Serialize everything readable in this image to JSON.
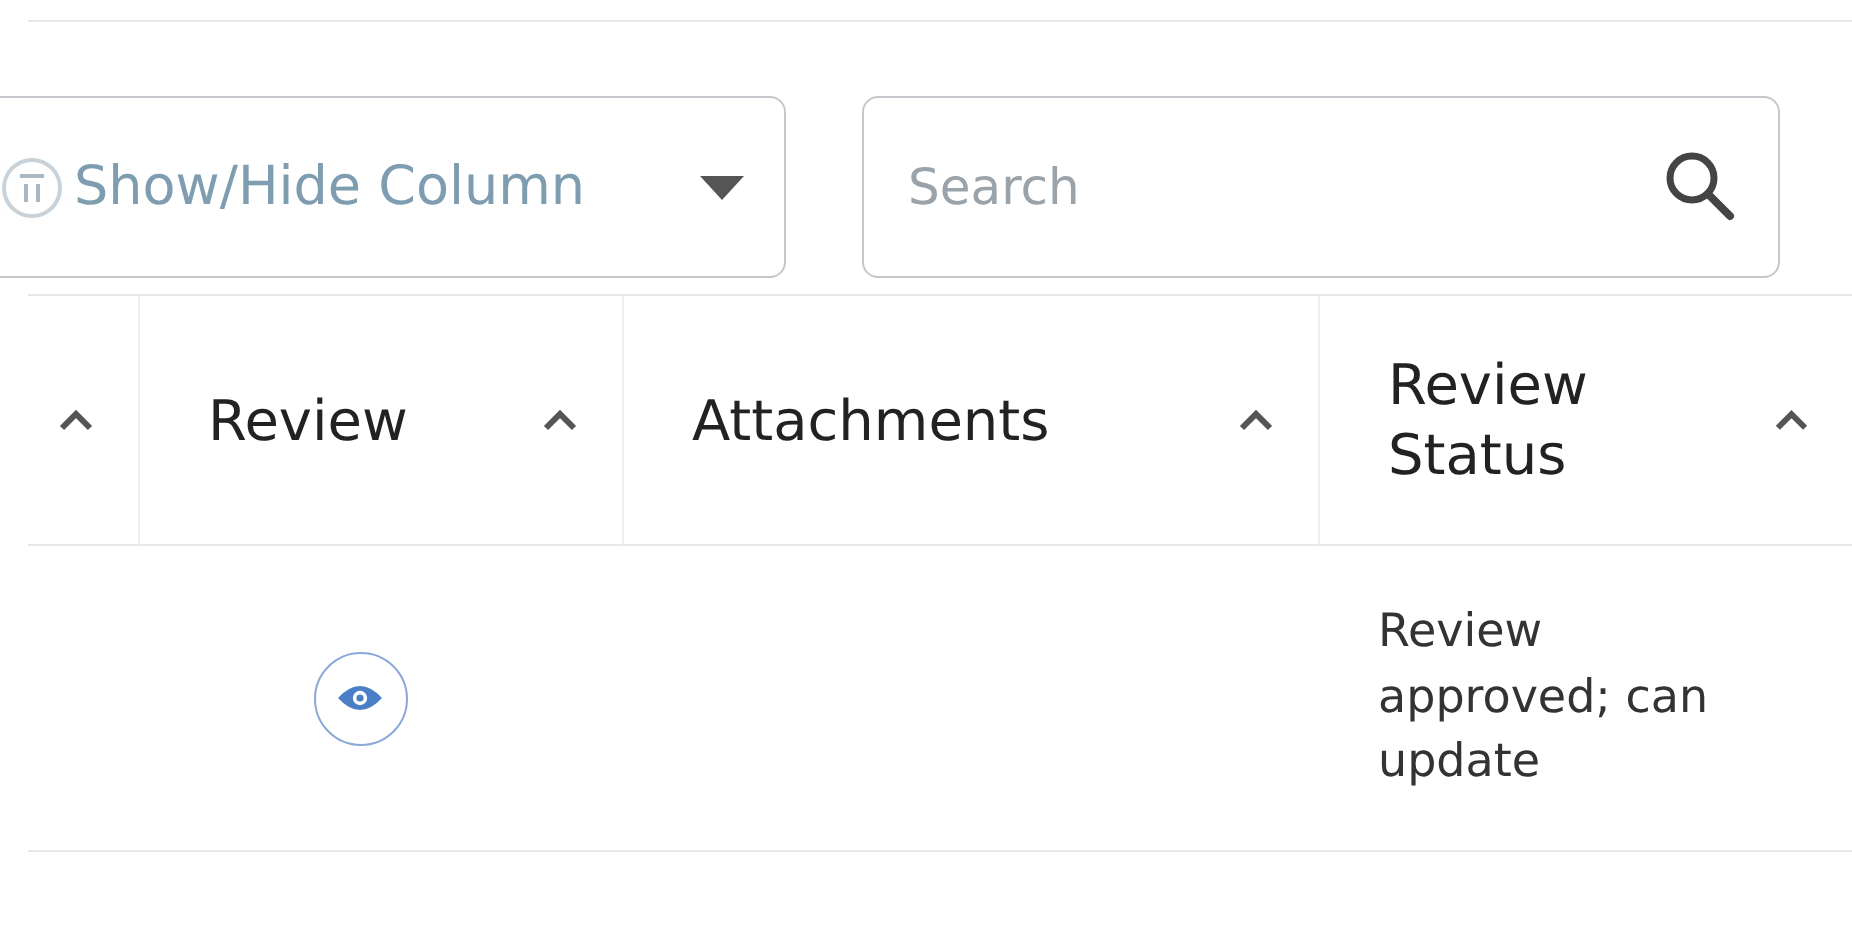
{
  "toolbar": {
    "column_toggle": {
      "label": "Show/Hide Column"
    },
    "search": {
      "placeholder": "Search"
    }
  },
  "table": {
    "columns": [
      {
        "kind": "partial"
      },
      {
        "kind": "labeled",
        "label": "Review"
      },
      {
        "kind": "labeled",
        "label": "Attachments"
      },
      {
        "kind": "labeled",
        "label": "Review Status"
      }
    ],
    "rows": [
      {
        "cells": [
          {
            "kind": "empty"
          },
          {
            "kind": "view"
          },
          {
            "kind": "empty"
          },
          {
            "kind": "text",
            "text": "Review approved; can update"
          }
        ]
      }
    ]
  }
}
